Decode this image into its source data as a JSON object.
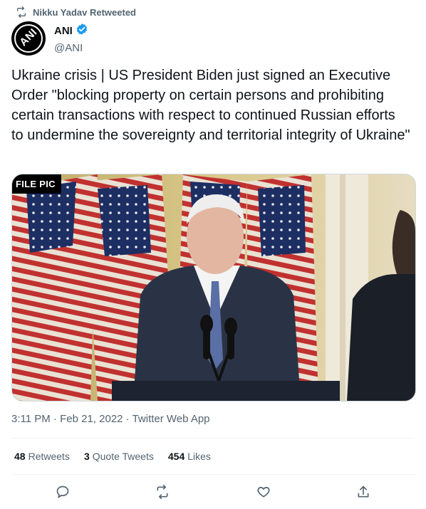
{
  "retweet_banner": {
    "text": "Nikku Yadav Retweeted"
  },
  "author": {
    "name": "ANI",
    "handle": "@ANI",
    "avatar_text": "ANI"
  },
  "tweet": {
    "text": "Ukraine crisis | US President Biden just signed an Executive Order \"blocking property on certain persons and prohibiting certain transactions with respect to continued Russian efforts to undermine the sovereignty and territorial integrity of Ukraine\""
  },
  "media": {
    "badge": "FILE PIC"
  },
  "meta": {
    "time": "3:11 PM",
    "sep1": " · ",
    "date": "Feb 21, 2022",
    "sep2": " · ",
    "source": "Twitter Web App"
  },
  "stats": {
    "retweets_count": "48",
    "retweets_label": "Retweets",
    "quotes_count": "3",
    "quotes_label": "Quote Tweets",
    "likes_count": "454",
    "likes_label": "Likes"
  },
  "colors": {
    "verified": "#1d9bf0",
    "secondary_text": "#536471",
    "divider": "#eff3f4"
  },
  "icons": [
    "retweet-icon",
    "verified-badge-icon",
    "reply-icon",
    "retweet-action-icon",
    "like-icon",
    "share-icon"
  ]
}
